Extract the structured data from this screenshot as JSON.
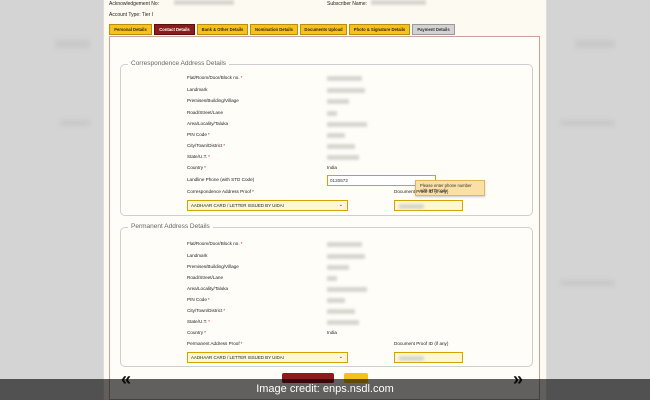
{
  "header": {
    "ack_label": "Acknowledgement No:",
    "subscriber_label": "Subscriber Name:",
    "account_type_label": "Account Type:",
    "account_type_value": "Tier I"
  },
  "tabs": [
    {
      "label": "Personal Details",
      "state": "normal"
    },
    {
      "label": "Contact Details",
      "state": "active"
    },
    {
      "label": "Bank & Other Details",
      "state": "normal"
    },
    {
      "label": "Nomination Details",
      "state": "normal"
    },
    {
      "label": "Documents Upload",
      "state": "normal"
    },
    {
      "label": "Photo & Signature Details",
      "state": "normal"
    },
    {
      "label": "Payment Details",
      "state": "inactive"
    }
  ],
  "correspondence": {
    "legend": "Correspondence Address Details",
    "fields": [
      {
        "label": "Flat/Room/Door/Block no.",
        "required": true
      },
      {
        "label": "Landmark",
        "required": false
      },
      {
        "label": "Premises/Building/Village",
        "required": false
      },
      {
        "label": "Road/Street/Lane",
        "required": false
      },
      {
        "label": "Area/Locality/Taluka",
        "required": false
      },
      {
        "label": "PIN Code",
        "required": true
      },
      {
        "label": "City/Town/District",
        "required": true
      },
      {
        "label": "State/U.T.",
        "required": true
      },
      {
        "label": "Country",
        "required": true
      }
    ],
    "country_value": "India",
    "landline_label": "Landline Phone (with STD Code)",
    "landline_value": "0120672",
    "tooltip": "Please enter phone number with STD code",
    "proof_label": "Correspondence Address Proof",
    "proof_value": "AADHAAR CARD / LETTER ISSUED BY UIDAI",
    "doc_proof_label": "Document Proof ID (if any)"
  },
  "permanent": {
    "legend": "Permanent Address Details",
    "fields": [
      {
        "label": "Flat/Room/Door/Block no.",
        "required": true
      },
      {
        "label": "Landmark",
        "required": false
      },
      {
        "label": "Premises/Building/Village",
        "required": false
      },
      {
        "label": "Road/Street/Lane",
        "required": false
      },
      {
        "label": "Area/Locality/Taluka",
        "required": false
      },
      {
        "label": "PIN Code",
        "required": true
      },
      {
        "label": "City/Town/District",
        "required": true
      },
      {
        "label": "State/U.T.",
        "required": true
      },
      {
        "label": "Country",
        "required": true
      }
    ],
    "country_value": "India",
    "proof_label": "Permanent Address Proof",
    "proof_value": "AADHAAR CARD / LETTER ISSUED BY UIDAI",
    "doc_proof_label": "Document Proof ID (if any)"
  },
  "nav": {
    "prev_glyph": "«",
    "next_glyph": "»"
  },
  "caption": "Image credit: enps.nsdl.com",
  "colors": {
    "tab_active": "#8e1b1b",
    "tab_normal": "#f6c21a",
    "accent": "#d4a300"
  }
}
